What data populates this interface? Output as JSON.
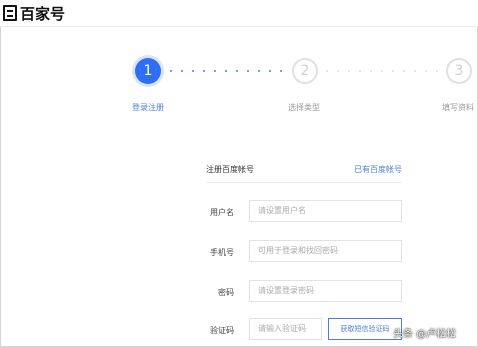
{
  "header": {
    "logo_text": "百家号"
  },
  "stepper": {
    "steps": [
      {
        "number": "1",
        "label": "登录注册",
        "state": "active"
      },
      {
        "number": "2",
        "label": "选择类型",
        "state": "inactive"
      },
      {
        "number": "3",
        "label": "填写资料",
        "state": "inactive"
      }
    ]
  },
  "form": {
    "title": "注册百度帐号",
    "login_link": "已有百度帐号",
    "username": {
      "label": "用户名",
      "placeholder": "请设置用户名"
    },
    "phone": {
      "label": "手机号",
      "placeholder": "可用于登录和找回密码"
    },
    "password": {
      "label": "密码",
      "placeholder": "请设置登录密码"
    },
    "captcha": {
      "label": "验证码",
      "placeholder": "请输入验证码",
      "button_label": "获取短信验证码"
    }
  },
  "watermark": "头条 @卢松松",
  "colors": {
    "accent": "#2f6ff5",
    "link": "#4a7fd9",
    "inactive": "#e1e1e1"
  }
}
